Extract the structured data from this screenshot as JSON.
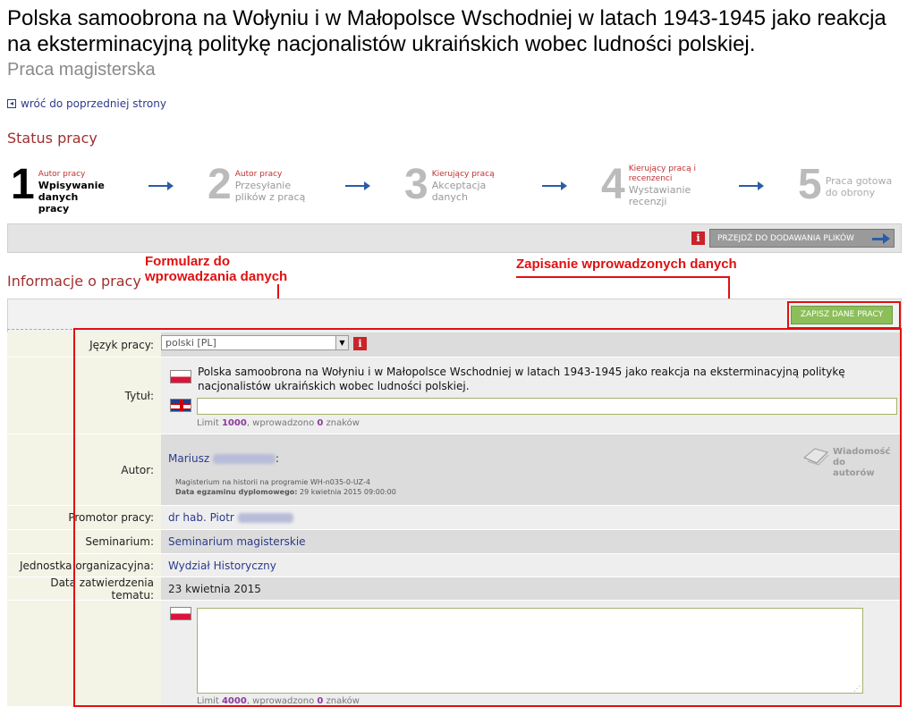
{
  "page": {
    "title": "Polska samoobrona na Wołyniu i w Małopolsce Wschodniej w latach 1943-1945 jako reakcja na eksterminacyjną politykę nacjonalistów ukraińskich wobec ludności polskiej.",
    "subtitle": "Praca magisterska",
    "back_link": "wróć do poprzedniej strony"
  },
  "status": {
    "heading": "Status pracy",
    "steps": [
      {
        "num": "1",
        "role": "Autor pracy",
        "action": "Wpisywanie danych pracy"
      },
      {
        "num": "2",
        "role": "Autor pracy",
        "action": "Przesyłanie plików z pracą"
      },
      {
        "num": "3",
        "role": "Kierujący pracą",
        "action": "Akceptacja danych"
      },
      {
        "num": "4",
        "role": "Kierujący pracą i recenzenci",
        "action": "Wystawianie recenzji"
      },
      {
        "num": "5",
        "role": "",
        "action": "Praca gotowa do obrony"
      }
    ]
  },
  "toolbar": {
    "next_button": "PRZEJDŹ DO DODAWANIA PLIKÓW"
  },
  "annotations": {
    "form": "Formularz do\nwprowadzania danych",
    "save": "Zapisanie wprowadzonych danych"
  },
  "info": {
    "heading": "Informacje o pracy",
    "save_button": "ZAPISZ DANE PRACY"
  },
  "form": {
    "language_label": "Język pracy:",
    "language_value": "polski [PL]",
    "title_label": "Tytuł:",
    "title_pl": "Polska samoobrona na Wołyniu i w Małopolsce Wschodniej w latach 1943-1945 jako reakcja na eksterminacyjną politykę nacjonalistów ukraińskich wobec ludności polskiej.",
    "title_limit_prefix": "Limit ",
    "title_limit": "1000",
    "title_limit_mid": ", wprowadzono ",
    "title_count": "0",
    "title_limit_suffix": " znaków",
    "author_label": "Autor:",
    "author_name": "Mariusz",
    "author_program": "Magisterium na historii na programie WH-n035-0-UZ-4",
    "exam_label": "Data egzaminu dyplomowego:",
    "exam_date": "29 kwietnia 2015 09:00:00",
    "message_label": "Wiadomość do autorów",
    "promoter_label": "Promotor pracy:",
    "promoter_value": "dr hab. Piotr",
    "seminar_label": "Seminarium:",
    "seminar_value": "Seminarium magisterskie",
    "unit_label": "Jednostka organizacyjna:",
    "unit_value": "Wydział Historyczny",
    "approval_label": "Data zatwierdzenia tematu:",
    "approval_value": "23 kwietnia 2015",
    "abstract_limit_prefix": "Limit ",
    "abstract_limit": "4000",
    "abstract_limit_mid": ", wprowadzono ",
    "abstract_count": "0",
    "abstract_limit_suffix": " znaków"
  }
}
